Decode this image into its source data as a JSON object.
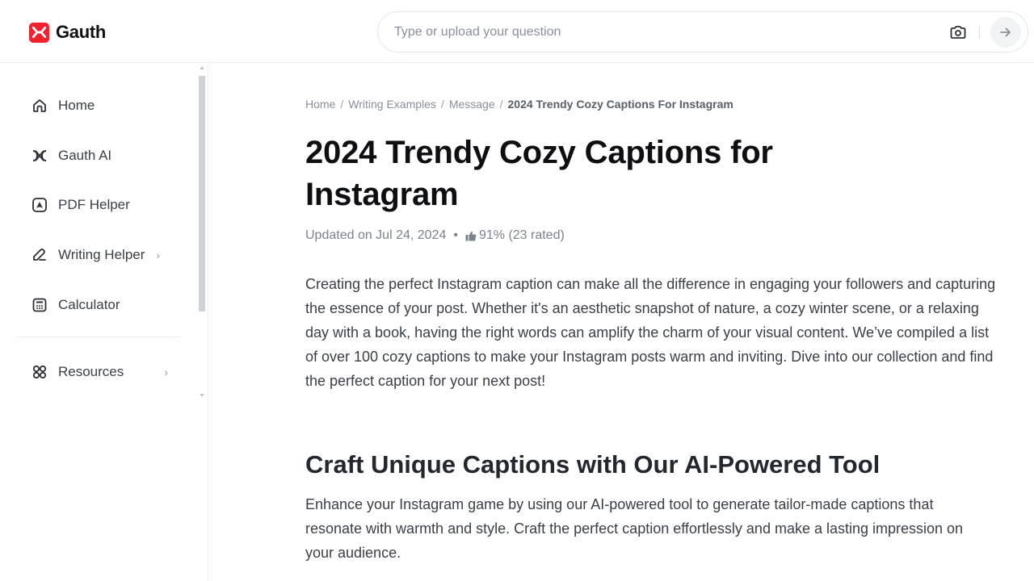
{
  "brand": {
    "name": "Gauth",
    "color": "#f5222d"
  },
  "search": {
    "placeholder": "Type or upload your question",
    "value": ""
  },
  "sidebar": {
    "items": [
      {
        "label": "Home",
        "icon": "home-icon"
      },
      {
        "label": "Gauth AI",
        "icon": "gauth-ai-icon"
      },
      {
        "label": "PDF Helper",
        "icon": "pdf-icon"
      },
      {
        "label": "Writing Helper",
        "icon": "pen-icon",
        "has_submenu": true
      },
      {
        "label": "Calculator",
        "icon": "calculator-icon"
      },
      {
        "label": "Resources",
        "icon": "grid-icon",
        "has_submenu": true
      }
    ],
    "chevron": "›"
  },
  "breadcrumb": {
    "items": [
      "Home",
      "Writing Examples",
      "Message"
    ],
    "current": "2024 Trendy Cozy Captions For Instagram",
    "separator": "/"
  },
  "article": {
    "title": "2024 Trendy Cozy Captions for Instagram",
    "updated": "Updated on Jul 24, 2024",
    "bullet": "•",
    "rating": "91% (23 rated)",
    "intro": "Creating the perfect Instagram caption can make all the difference in engaging your followers and capturing the essence of your post. Whether it's an aesthetic snapshot of nature, a cozy winter scene, or a relaxing day with a book, having the right words can amplify the charm of your visual content. We’ve compiled a list of over 100 cozy captions to make your Instagram posts warm and inviting. Dive into our collection and find the perfect caption for your next post!",
    "section_heading": "Craft Unique Captions with Our AI-Powered Tool",
    "section_body": "Enhance your Instagram game by using our AI-powered tool to generate tailor-made captions that resonate with warmth and style. Craft the perfect caption effortlessly and make a lasting impression on your audience."
  }
}
